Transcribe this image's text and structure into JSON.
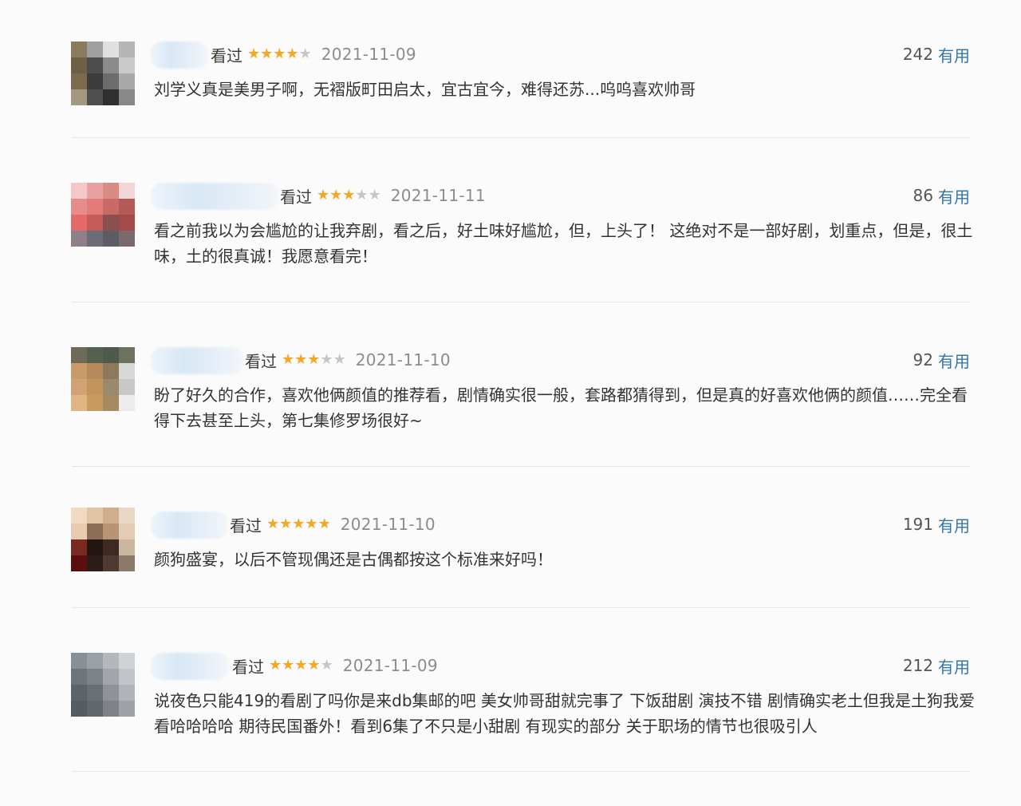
{
  "useful_label": "有用",
  "watched_label": "看过",
  "comments": [
    {
      "stars": 4,
      "date": "2021-11-09",
      "useful_count": "242",
      "text": "刘学义真是美男子啊，无褶版町田启太，宜古宜今，难得还苏...呜呜喜欢帅哥"
    },
    {
      "stars": 3,
      "date": "2021-11-11",
      "useful_count": "86",
      "text": "看之前我以为会尴尬的让我弃剧，看之后，好土味好尴尬，但，上头了！ 这绝对不是一部好剧，划重点，但是，很土味，土的很真诚！我愿意看完！"
    },
    {
      "stars": 3,
      "date": "2021-11-10",
      "useful_count": "92",
      "text": "盼了好久的合作，喜欢他俩颜值的推荐看，剧情确实很一般，套路都猜得到，但是真的好喜欢他俩的颜值……完全看得下去甚至上头，第七集修罗场很好~"
    },
    {
      "stars": 5,
      "date": "2021-11-10",
      "useful_count": "191",
      "text": "颜狗盛宴，以后不管现偶还是古偶都按这个标准来好吗！"
    },
    {
      "stars": 4,
      "date": "2021-11-09",
      "useful_count": "212",
      "text": "说夜色只能419的看剧了吗你是来db集邮的吧 美女帅哥甜就完事了 下饭甜剧 演技不错 剧情确实老土但我是土狗我爱看哈哈哈哈 期待民国番外！看到6集了不只是小甜剧 有现实的部分 关于职场的情节也很吸引人"
    }
  ]
}
